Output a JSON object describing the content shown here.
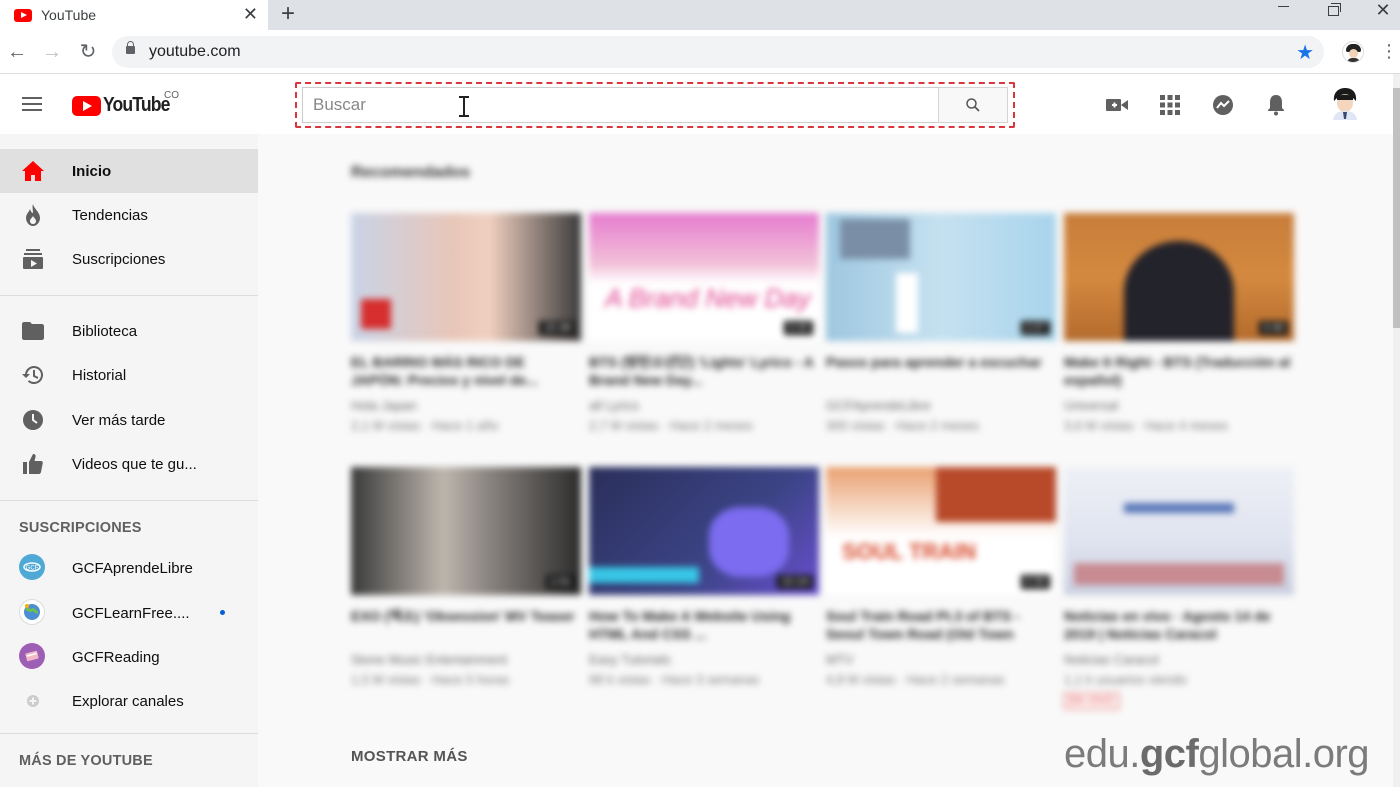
{
  "browser": {
    "tab_title": "YouTube",
    "tab_close": "✕",
    "new_tab": "+",
    "url": "youtube.com"
  },
  "header": {
    "logo_text": "YouTube",
    "country_code": "CO",
    "search_placeholder": "Buscar"
  },
  "sidebar": {
    "main_items": [
      {
        "label": "Inicio",
        "icon": "home-icon",
        "active": true
      },
      {
        "label": "Tendencias",
        "icon": "flame-icon"
      },
      {
        "label": "Suscripciones",
        "icon": "subscriptions-icon"
      }
    ],
    "library_items": [
      {
        "label": "Biblioteca",
        "icon": "folder-icon"
      },
      {
        "label": "Historial",
        "icon": "history-icon"
      },
      {
        "label": "Ver más tarde",
        "icon": "clock-icon"
      },
      {
        "label": "Videos que te gu...",
        "icon": "thumbs-up-icon"
      }
    ],
    "subscriptions_heading": "SUSCRIPCIONES",
    "subscriptions": [
      {
        "label": "GCFAprendeLibre"
      },
      {
        "label": "GCFLearnFree...."
      },
      {
        "label": "GCFReading"
      },
      {
        "label": "Explorar canales"
      }
    ],
    "more_heading": "MÁS DE YOUTUBE"
  },
  "main": {
    "section_title": "Recomendados",
    "videos": [
      {
        "title": "EL BARRIO MÁS RICO DE JAPÓN: Precios y nivel de...",
        "channel": "Hola Japan",
        "meta": "2,1 M vistas · Hace 1 año",
        "duration": "15:38"
      },
      {
        "title": "BTS (방탄소년단) 'Lights' Lyrics - A Brand New Day...",
        "channel": "all Lyrics",
        "meta": "2,7 M vistas · Hace 2 meses",
        "duration": "3:40"
      },
      {
        "title": "Pasos para aprender a escuchar",
        "channel": "GCFAprendeLibre",
        "meta": "300 vistas · Hace 2 meses",
        "duration": "2:07"
      },
      {
        "title": "Make It Right - BTS (Traducción al español)",
        "channel": "Universal",
        "meta": "3,6 M vistas · Hace 4 meses",
        "duration": "3:46"
      },
      {
        "title": "EXO (엑소) 'Obsession' MV Teaser",
        "channel": "Stone Music Entertainment",
        "meta": "1,5 M vistas · Hace 5 horas",
        "duration": "1:01"
      },
      {
        "title": "How To Make A Website Using HTML And CSS ...",
        "channel": "Easy Tutorials",
        "meta": "98 k vistas · Hace 3 semanas",
        "duration": "22:24"
      },
      {
        "title": "Soul Train Road Pt.3 of BTS - Seoul Town Road (Old Town Road...",
        "channel": "MTV",
        "meta": "4,8 M vistas · Hace 2 semanas",
        "duration": "4:30"
      },
      {
        "title": "Noticias en vivo · Agosto 14 de 2019 | Noticias Caracol",
        "channel": "Noticias Caracol",
        "meta": "1,1 k usuarios viendo",
        "duration": "",
        "live": "EN VIVO"
      }
    ],
    "show_more": "MOSTRAR MÁS"
  },
  "watermark": {
    "prefix": "edu.",
    "brand": "gcf",
    "suffix": "global.org"
  },
  "colors": {
    "youtube_red": "#ff0000",
    "highlight_dashed": "#d9363e",
    "sidebar_bg": "#f5f5f5",
    "active_item_bg": "#e0e0e0"
  }
}
